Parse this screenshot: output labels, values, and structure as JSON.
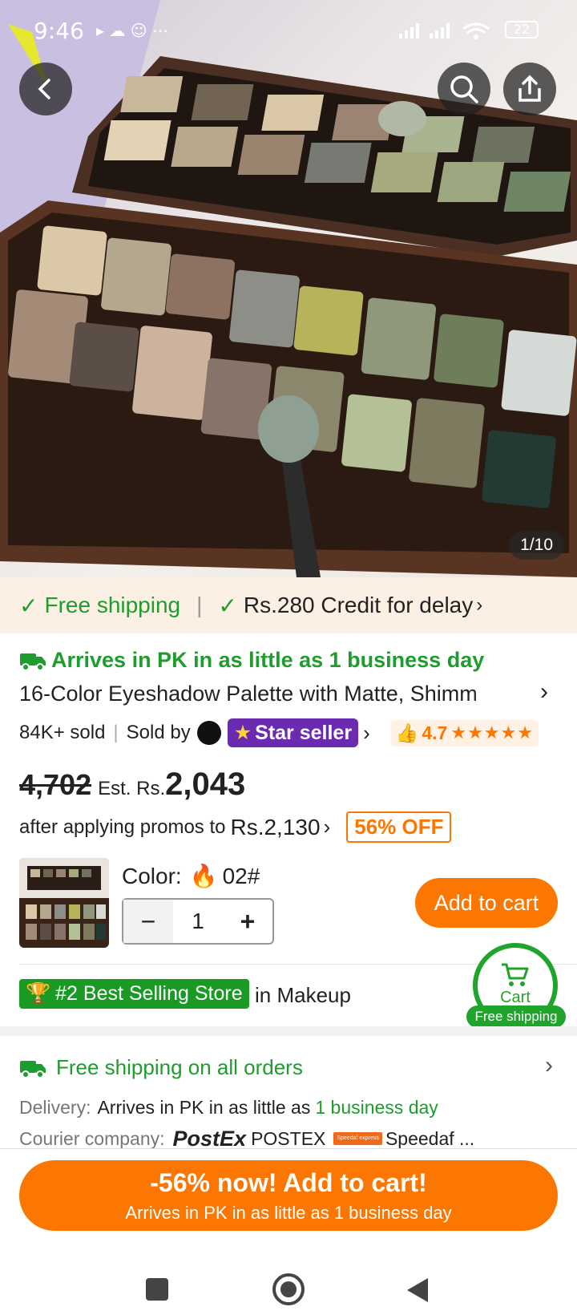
{
  "status_bar": {
    "time": "9:46",
    "extra": "▸ ☁ ☺ ⋯",
    "battery": "22"
  },
  "gallery": {
    "counter": "1/10"
  },
  "banner": {
    "free_shipping": "Free shipping",
    "credit": "Rs.280 Credit for delay"
  },
  "product": {
    "arrival": "Arrives in PK in as little as 1 business day",
    "title": "16-Color Eyeshadow Palette with Matte, Shimm",
    "sold": "84K+ sold",
    "sold_by": "Sold by",
    "star_seller": "Star seller",
    "rating": "4.7",
    "stars": "★★★★★",
    "original_price": "4,702",
    "est_label": "Est. Rs.",
    "est_price": "2,043",
    "promo_text": "after applying promos to",
    "promo_price": "Rs.2,130",
    "discount": "56% OFF",
    "color_label": "Color:",
    "color_value": "02#",
    "quantity": "1",
    "minus": "−",
    "plus": "+",
    "add_to_cart": "Add to cart",
    "best_selling": "#2 Best Selling Store",
    "best_selling_category": "in Makeup"
  },
  "cart_float": {
    "label": "Cart",
    "free_shipping": "Free shipping"
  },
  "shipping": {
    "title": "Free shipping on all orders",
    "delivery_label": "Delivery:",
    "delivery_text": "Arrives in PK in as little as",
    "delivery_highlight": "1 business day",
    "courier_label": "Courier company:",
    "courier_logo": "PostEx",
    "courier_postex": "POSTEX",
    "courier_speedaf_logo": "Speedaf express",
    "courier_speedaf": "Speedaf ..."
  },
  "cta": {
    "main": "-56% now! Add to cart!",
    "sub": "Arrives in PK in as little as 1 business day"
  },
  "colors": {
    "accent": "#fb7701",
    "green": "#1e9d2e",
    "star_purple": "#6a2bb0"
  }
}
